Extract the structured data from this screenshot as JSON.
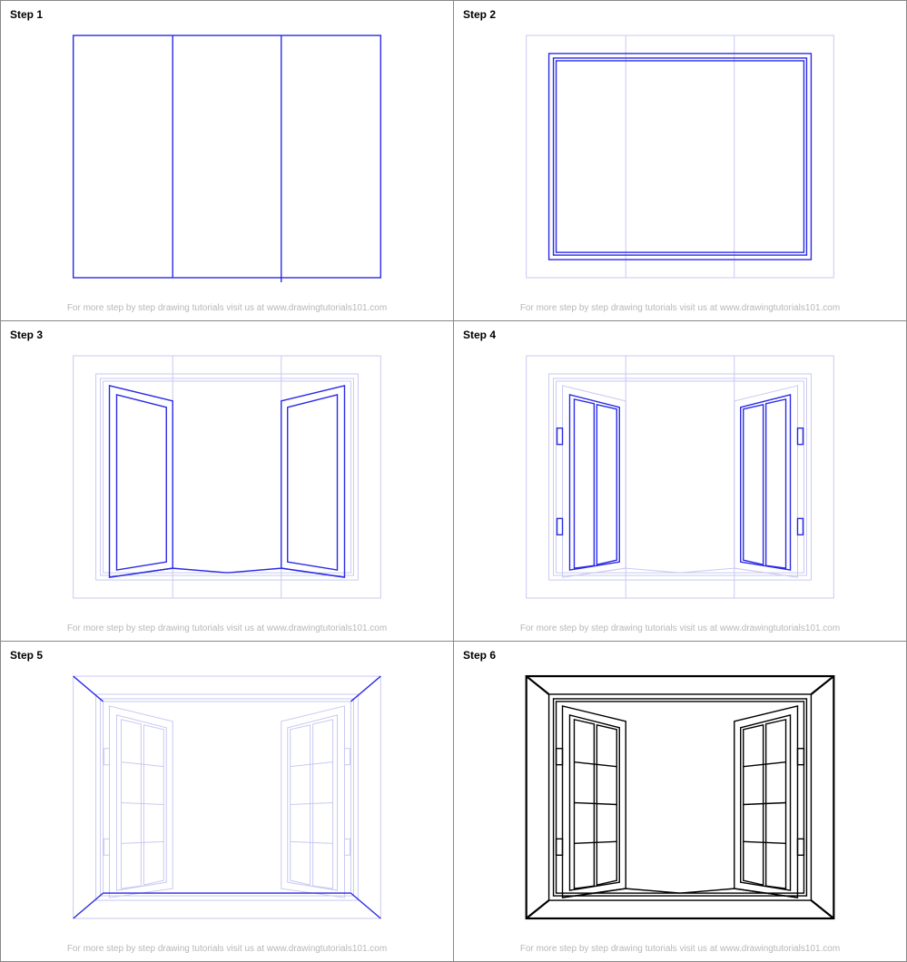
{
  "footer_text": "For more step by step drawing tutorials visit us at www.drawingtutorials101.com",
  "steps": {
    "s1": "Step 1",
    "s2": "Step 2",
    "s3": "Step 3",
    "s4": "Step 4",
    "s5": "Step 5",
    "s6": "Step 6"
  }
}
